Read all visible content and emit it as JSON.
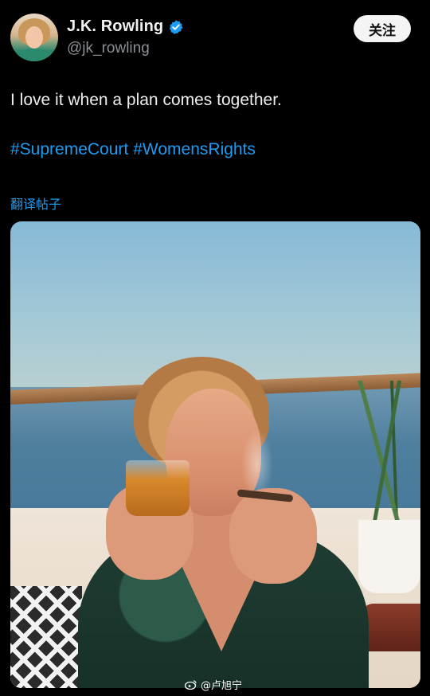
{
  "author": {
    "display_name": "J.K. Rowling",
    "handle": "@jk_rowling",
    "verified": true,
    "verified_color": "#1d9bf0"
  },
  "follow_button": {
    "label": "关注"
  },
  "tweet": {
    "text": "I love it when a plan comes together.",
    "hashtags": [
      "#SupremeCourt",
      "#WomensRights"
    ],
    "translate_link": "翻译帖子"
  },
  "media": {
    "kind": "photo"
  },
  "watermark": {
    "text": "@卢旭宁"
  },
  "colors": {
    "background": "#000000",
    "link": "#1d9bf0",
    "secondary_text": "#8b8f95",
    "primary_text": "#eceef0"
  }
}
